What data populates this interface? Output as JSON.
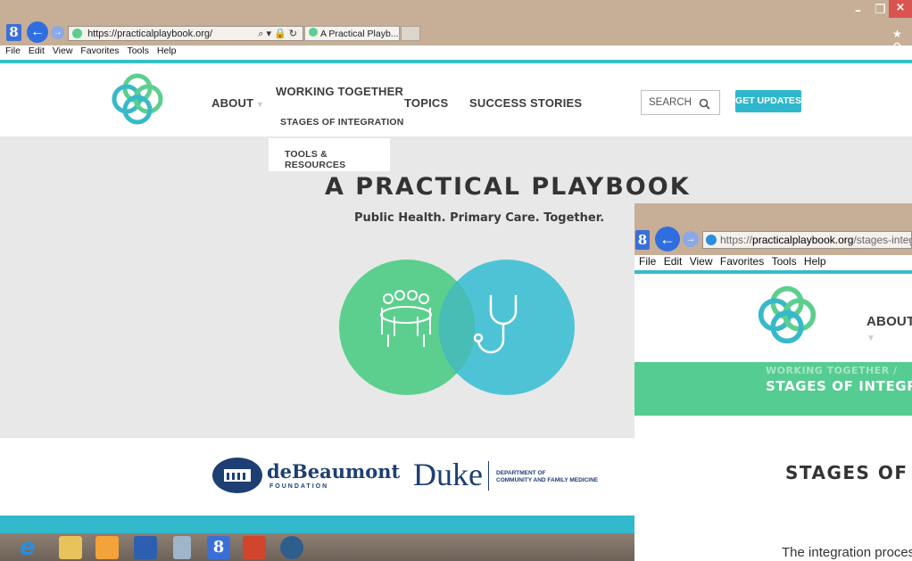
{
  "back_window": {
    "address": "https://practicalplaybook.org/",
    "search_glyphs": "⌕ ▾ 🔒 ↻",
    "tab_title": "A Practical Playb...",
    "tab_close": "×",
    "menu": [
      "File",
      "Edit",
      "View",
      "Favorites",
      "Tools",
      "Help"
    ],
    "window_controls": {
      "minimize": "–",
      "restore": "❐",
      "close": "×"
    },
    "star": "★ ⚙"
  },
  "site": {
    "nav": {
      "about": "ABOUT",
      "working_together": "WORKING TOGETHER",
      "topics": "TOPICS",
      "success_stories": "SUCCESS STORIES"
    },
    "dropdown": [
      "STAGES OF INTEGRATION",
      "TOOLS & RESOURCES"
    ],
    "search_placeholder": "SEARCH",
    "get_updates": "GET UPDATES",
    "hero_title": "A PRACTICAL PLAYBOOK",
    "hero_subtitle": "Public Health. Primary Care. Together.",
    "sponsors": {
      "debeaumont_name": "deBeaumont",
      "debeaumont_sub": "FOUNDATION",
      "duke": "Duke",
      "duke_dept_line1": "DEPARTMENT OF",
      "duke_dept_line2": "COMMUNITY AND FAMILY MEDICINE"
    },
    "colors": {
      "teal": "#35bccd",
      "green": "#55cc92",
      "venn_green": "#5ccf8e",
      "venn_blue": "#4fc3d6"
    }
  },
  "front_window": {
    "address_prefix": "https://",
    "address_domain": "practicalplaybook.org",
    "address_path": "/stages-integra",
    "menu": [
      "File",
      "Edit",
      "View",
      "Favorites",
      "Tools",
      "Help"
    ],
    "nav_about": "ABOUT",
    "breadcrumb": "WORKING TOGETHER  /",
    "band_title": "STAGES OF INTEGRATIC",
    "page_heading": "STAGES OF IN",
    "page_text": "The integration process"
  },
  "taskbar": {
    "icons": [
      "internet-explorer-icon",
      "file-explorer-icon",
      "outlook-icon",
      "word-icon",
      "calculator-icon",
      "google-icon",
      "powerpoint-icon",
      "app-icon"
    ]
  }
}
